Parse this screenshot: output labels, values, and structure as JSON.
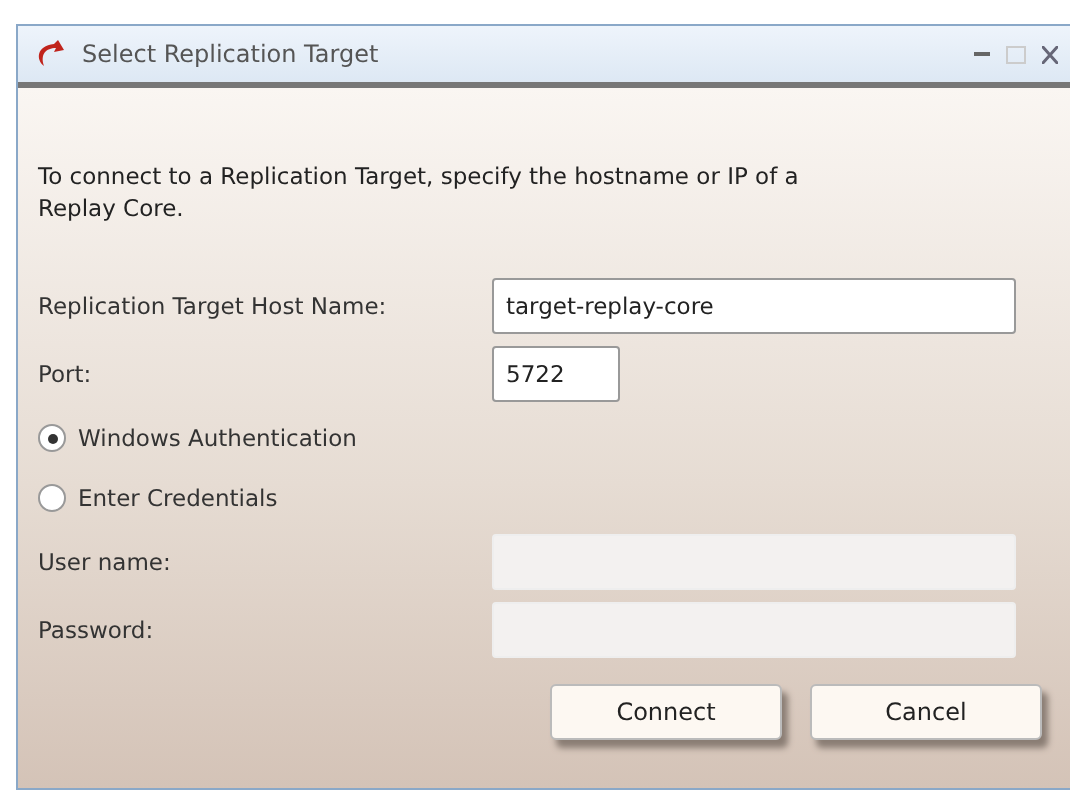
{
  "window": {
    "title": "Select Replication Target"
  },
  "intro": "To connect to a Replication Target, specify the hostname or IP of a Replay Core.",
  "fields": [
    {
      "label": "Replication Target Host Name:",
      "value": "target-replay-core",
      "kind": "host",
      "disabled": false
    },
    {
      "label": "Port:",
      "value": "5722",
      "kind": "port",
      "disabled": false
    }
  ],
  "auth_options": [
    {
      "label": "Windows Authentication",
      "selected": true
    },
    {
      "label": "Enter Credentials",
      "selected": false
    }
  ],
  "credentials": [
    {
      "label": "User name:",
      "disabled": true
    },
    {
      "label": "Password:",
      "disabled": true
    }
  ],
  "buttons": [
    "Connect",
    "Cancel"
  ]
}
